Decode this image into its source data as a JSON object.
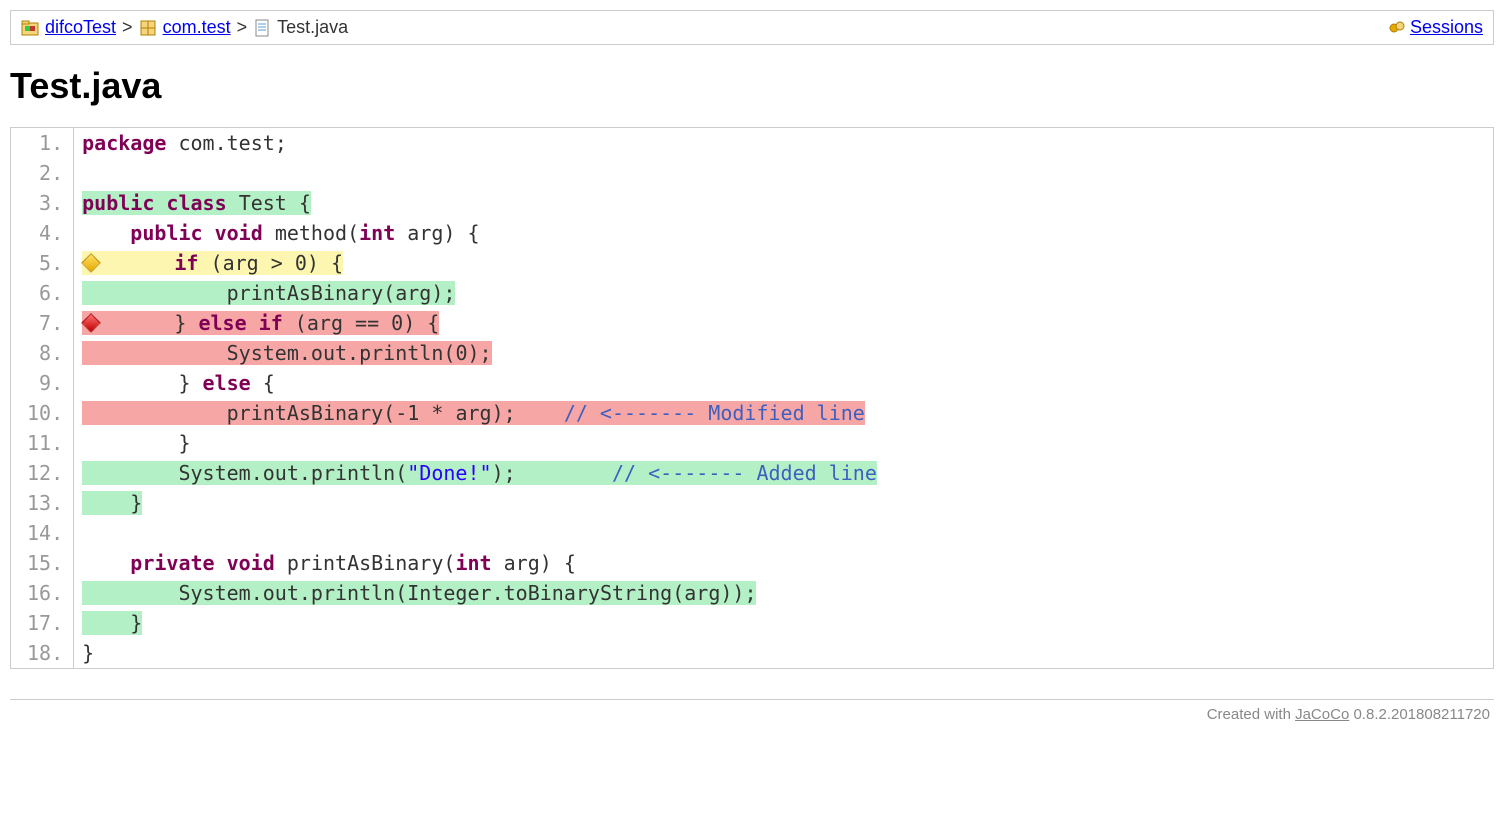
{
  "breadcrumb": {
    "project": "difcoTest",
    "package": "com.test",
    "file": "Test.java",
    "sessions": "Sessions",
    "sep": ">"
  },
  "title": "Test.java",
  "code": {
    "lines": [
      {
        "n": 1,
        "cov": "none",
        "tokens": [
          [
            "keyword",
            "package"
          ],
          [
            "punct",
            " "
          ],
          [
            "name",
            "com"
          ],
          [
            "punct",
            "."
          ],
          [
            "name",
            "test"
          ],
          [
            "punct",
            ";"
          ]
        ]
      },
      {
        "n": 2,
        "cov": "none",
        "tokens": []
      },
      {
        "n": 3,
        "cov": "full",
        "tokens": [
          [
            "keyword",
            "public"
          ],
          [
            "punct",
            " "
          ],
          [
            "keyword",
            "class"
          ],
          [
            "punct",
            " "
          ],
          [
            "name",
            "Test"
          ],
          [
            "punct",
            " {"
          ]
        ]
      },
      {
        "n": 4,
        "cov": "none",
        "tokens": [
          [
            "punct",
            "    "
          ],
          [
            "keyword",
            "public"
          ],
          [
            "punct",
            " "
          ],
          [
            "keyword",
            "void"
          ],
          [
            "punct",
            " "
          ],
          [
            "name",
            "method"
          ],
          [
            "punct",
            "("
          ],
          [
            "keyword",
            "int"
          ],
          [
            "punct",
            " "
          ],
          [
            "name",
            "arg"
          ],
          [
            "punct",
            ") {"
          ]
        ]
      },
      {
        "n": 5,
        "cov": "partial",
        "diamond": "yellow",
        "tokens": [
          [
            "punct",
            "      "
          ],
          [
            "keyword",
            "if"
          ],
          [
            "punct",
            " ("
          ],
          [
            "name",
            "arg"
          ],
          [
            "punct",
            " > "
          ],
          [
            "num",
            "0"
          ],
          [
            "punct",
            ") {"
          ]
        ]
      },
      {
        "n": 6,
        "cov": "full",
        "tokens": [
          [
            "punct",
            "            "
          ],
          [
            "name",
            "printAsBinary"
          ],
          [
            "punct",
            "("
          ],
          [
            "name",
            "arg"
          ],
          [
            "punct",
            ");"
          ]
        ]
      },
      {
        "n": 7,
        "cov": "not",
        "diamond": "red",
        "tokens": [
          [
            "punct",
            "      } "
          ],
          [
            "keyword",
            "else"
          ],
          [
            "punct",
            " "
          ],
          [
            "keyword",
            "if"
          ],
          [
            "punct",
            " ("
          ],
          [
            "name",
            "arg"
          ],
          [
            "punct",
            " == "
          ],
          [
            "num",
            "0"
          ],
          [
            "punct",
            ") {"
          ]
        ]
      },
      {
        "n": 8,
        "cov": "not",
        "tokens": [
          [
            "punct",
            "            "
          ],
          [
            "name",
            "System"
          ],
          [
            "punct",
            "."
          ],
          [
            "name",
            "out"
          ],
          [
            "punct",
            "."
          ],
          [
            "name",
            "println"
          ],
          [
            "punct",
            "("
          ],
          [
            "num",
            "0"
          ],
          [
            "punct",
            ");"
          ]
        ]
      },
      {
        "n": 9,
        "cov": "none",
        "tokens": [
          [
            "punct",
            "        } "
          ],
          [
            "keyword",
            "else"
          ],
          [
            "punct",
            " {"
          ]
        ]
      },
      {
        "n": 10,
        "cov": "not",
        "tokens": [
          [
            "punct",
            "            "
          ],
          [
            "name",
            "printAsBinary"
          ],
          [
            "punct",
            "("
          ],
          [
            "num",
            "-1"
          ],
          [
            "punct",
            " * "
          ],
          [
            "name",
            "arg"
          ],
          [
            "punct",
            ");    "
          ],
          [
            "comment",
            "// <------- Modified line"
          ]
        ]
      },
      {
        "n": 11,
        "cov": "none",
        "tokens": [
          [
            "punct",
            "        }"
          ]
        ]
      },
      {
        "n": 12,
        "cov": "full",
        "tokens": [
          [
            "punct",
            "        "
          ],
          [
            "name",
            "System"
          ],
          [
            "punct",
            "."
          ],
          [
            "name",
            "out"
          ],
          [
            "punct",
            "."
          ],
          [
            "name",
            "println"
          ],
          [
            "punct",
            "("
          ],
          [
            "string",
            "\"Done!\""
          ],
          [
            "punct",
            ");        "
          ],
          [
            "comment",
            "// <------- Added line"
          ]
        ]
      },
      {
        "n": 13,
        "cov": "full",
        "tokens": [
          [
            "punct",
            "    }"
          ]
        ]
      },
      {
        "n": 14,
        "cov": "none",
        "tokens": []
      },
      {
        "n": 15,
        "cov": "none",
        "tokens": [
          [
            "punct",
            "    "
          ],
          [
            "keyword",
            "private"
          ],
          [
            "punct",
            " "
          ],
          [
            "keyword",
            "void"
          ],
          [
            "punct",
            " "
          ],
          [
            "name",
            "printAsBinary"
          ],
          [
            "punct",
            "("
          ],
          [
            "keyword",
            "int"
          ],
          [
            "punct",
            " "
          ],
          [
            "name",
            "arg"
          ],
          [
            "punct",
            ") {"
          ]
        ]
      },
      {
        "n": 16,
        "cov": "full",
        "tokens": [
          [
            "punct",
            "        "
          ],
          [
            "name",
            "System"
          ],
          [
            "punct",
            "."
          ],
          [
            "name",
            "out"
          ],
          [
            "punct",
            "."
          ],
          [
            "name",
            "println"
          ],
          [
            "punct",
            "("
          ],
          [
            "name",
            "Integer"
          ],
          [
            "punct",
            "."
          ],
          [
            "name",
            "toBinaryString"
          ],
          [
            "punct",
            "("
          ],
          [
            "name",
            "arg"
          ],
          [
            "punct",
            "));"
          ]
        ]
      },
      {
        "n": 17,
        "cov": "full",
        "tokens": [
          [
            "punct",
            "    }"
          ]
        ]
      },
      {
        "n": 18,
        "cov": "none",
        "tokens": [
          [
            "punct",
            "}"
          ]
        ]
      }
    ]
  },
  "footer": {
    "prefix": "Created with ",
    "link": "JaCoCo",
    "version": " 0.8.2.201808211720"
  }
}
